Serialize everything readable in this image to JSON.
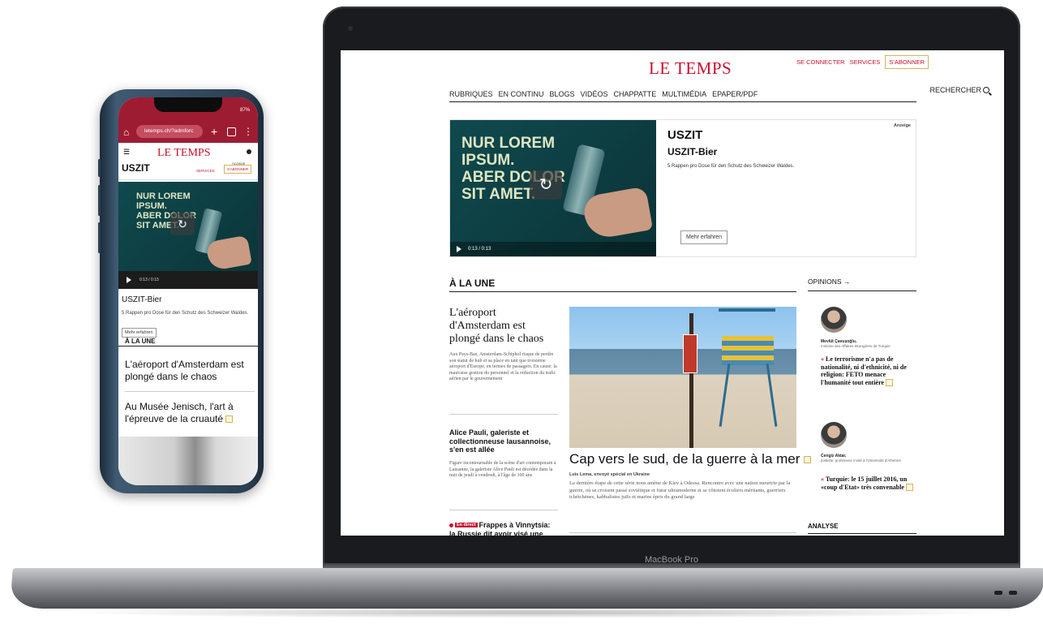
{
  "laptop": {
    "label": "MacBook Pro",
    "site": {
      "logo": "LE TEMPS",
      "top_links": {
        "login": "SE CONNECTER",
        "services": "SERVICES",
        "subscribe": "S'ABONNER"
      },
      "nav": [
        "RUBRIQUES",
        "EN CONTINU",
        "BLOGS",
        "VIDÉOS",
        "CHAPPATTE",
        "MULTIMÉDIA",
        "EPAPER/PDF"
      ],
      "search_label": "RECHERCHER",
      "ad": {
        "headline": "NUR LOREM\nIPSUM.\nABER DOLOR\nSIT AMET.",
        "brand": "USZIT",
        "product": "USZIT-Bier",
        "description": "5 Rappen pro Dose für den Schutz des Schweizer Waldes.",
        "label": "Anzeige",
        "button": "Mehr erfahren",
        "time": "0:13 / 0:13"
      },
      "section_title": "À LA UNE",
      "opinions_title": "OPINIONS →",
      "story1": {
        "title": "L'aéroport d'Amsterdam est plongé dans le chaos",
        "text": "Aux Pays-Bas, Amsterdam-Schiphol risque de perdre son statut de hub et sa place en tant que troisième aéroport d'Europe, en termes de passagers. En cause: la mauvaise gestion du personnel et la réduction du trafic aérien par le gouvernement"
      },
      "story2": {
        "title": "Alice Pauli, galeriste et collectionneuse lausannoise, s'en est allée",
        "text": "Figure incontournable de la scène d'art contemporain à Lausanne, la galeriste Alice Pauli est décédée dans la nuit de jeudi à vendredi, à l'âge de 100 ans"
      },
      "story3": {
        "badge": "En direct",
        "title": "Frappes à Vinnytsia: la Russie dit avoir visé une"
      },
      "main_story": {
        "title": "Cap vers le sud, de la guerre à la mer",
        "byline": "Luis Lema, envoyé spécial en Ukraine",
        "text": "La dernière étape de cette série nous amène de Kiev à Odessa. Rencontre avec une nation meurtrie par la guerre, où se croisent passé soviétique et futur ultramoderne et se côtoient écoliers méritants, guerriers tchétchènes, kabbalistes juifs et marins épris du grand large"
      },
      "opinions": [
        {
          "name": "Mevlüt Çavuşoğlu,",
          "role": "ministre des Affaires étrangères de Turquie",
          "quote": "Le terrorisme n'a pas de nationalité, ni d'ethnicité, ni de religion: FETO menace l'humanité tout entière"
        },
        {
          "name": "Cengiz Aktar,",
          "role": "politiste, professeur invité à l'Université d'Athènes",
          "quote": "Turquie: le 15 juillet 2016, un «coup d'Etat» très convenable"
        }
      ],
      "analyse_title": "ANALYSE"
    }
  },
  "phone": {
    "status": "87%",
    "url": "letemps.ch/?admforc",
    "logo": "LE TEMPS",
    "brand": "USZIT",
    "services": "SERVICES",
    "subscribe": "S'ABONNER",
    "ad_label": "Anzeige",
    "ad_headline": "NUR LOREM\nIPSUM.\nABER DOLOR\nSIT AMET.",
    "time": "0:13 / 0:13",
    "product": "USZIT-Bier",
    "description": "5 Rappen pro Dose für den Schutz des Schweizer Waldes.",
    "button": "Mehr erfahren",
    "section_title": "À LA UNE",
    "story1": "L'aéroport d'Amsterdam est plongé dans le chaos",
    "story2": "Au Musée Jenisch, l'art à l'épreuve de la cruauté"
  }
}
